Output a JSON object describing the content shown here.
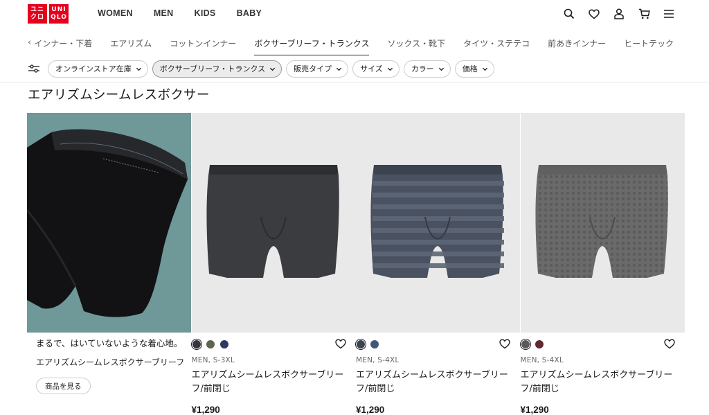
{
  "brand": {
    "logo_left": [
      "ユニ",
      "クロ"
    ],
    "logo_right": [
      "UNI",
      "QLO"
    ],
    "colors": {
      "red": "#e5001c"
    }
  },
  "nav": {
    "items": [
      "WOMEN",
      "MEN",
      "KIDS",
      "BABY"
    ],
    "icons": [
      "search-icon",
      "heart-icon",
      "user-icon",
      "cart-icon",
      "menu-icon"
    ]
  },
  "categories": {
    "back_arrow": "‹",
    "tabs": [
      {
        "label": "インナー・下着",
        "active": false
      },
      {
        "label": "エアリズム",
        "active": false
      },
      {
        "label": "コットンインナー",
        "active": false
      },
      {
        "label": "ボクサーブリーフ・トランクス",
        "active": true
      },
      {
        "label": "ソックス・靴下",
        "active": false
      },
      {
        "label": "タイツ・ステテコ",
        "active": false
      },
      {
        "label": "前あきインナー",
        "active": false
      },
      {
        "label": "ヒートテック",
        "active": false
      }
    ]
  },
  "filters": [
    {
      "label": "オンラインストア在庫",
      "selected": false
    },
    {
      "label": "ボクサーブリーフ・トランクス",
      "selected": true
    },
    {
      "label": "販売タイプ",
      "selected": false
    },
    {
      "label": "サイズ",
      "selected": false
    },
    {
      "label": "カラー",
      "selected": false
    },
    {
      "label": "価格",
      "selected": false
    }
  ],
  "section_title": "エアリズムシームレスボクサー",
  "promo": {
    "text": "まるで、はいていないような着心地。",
    "subtitle": "エアリズムシームレスボクサーブリーフ",
    "button": "商品を見る"
  },
  "products": [
    {
      "swatches": [
        "#33363d",
        "#5e6452",
        "#2f3a63"
      ],
      "selected_swatch": 0,
      "meta": "MEN, S-3XL",
      "name": "エアリズムシームレスボクサーブリーフ/前閉じ",
      "price": "¥1,290"
    },
    {
      "swatches": [
        "#3b4452",
        "#3f5878"
      ],
      "selected_swatch": 0,
      "meta": "MEN, S-4XL",
      "name": "エアリズムシームレスボクサーブリーフ/前閉じ",
      "price": "¥1,290"
    },
    {
      "swatches": [
        "#5a5a5a",
        "#5e2a33"
      ],
      "selected_swatch": 0,
      "meta": "MEN, S-4XL",
      "name": "エアリズムシームレスボクサーブリーフ/前閉じ",
      "price": "¥1,290"
    }
  ]
}
